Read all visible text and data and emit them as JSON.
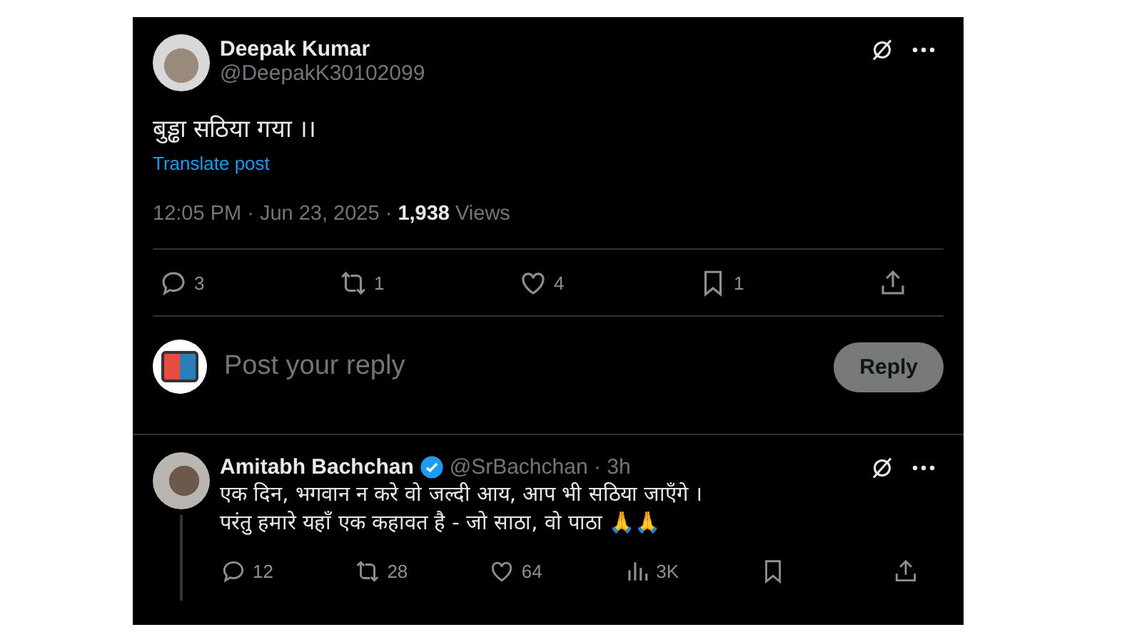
{
  "post": {
    "name": "Deepak Kumar",
    "handle": "@DeepakK30102099",
    "text": "बुड्ढा सठिया गया ।।",
    "translate": "Translate post",
    "time": "12:05 PM · Jun 23, 2025 · ",
    "views_count": "1,938",
    "views_label": " Views",
    "actions": [
      {
        "kind": "reply",
        "count": "3"
      },
      {
        "kind": "repost",
        "count": "1"
      },
      {
        "kind": "like",
        "count": "4"
      },
      {
        "kind": "bookmark",
        "count": "1"
      },
      {
        "kind": "share"
      }
    ]
  },
  "composer": {
    "placeholder": "Post your reply",
    "button": "Reply"
  },
  "reply": {
    "name": "Amitabh Bachchan",
    "verified": true,
    "handle": "@SrBachchan · 3h",
    "lines": [
      "एक दिन, भगवान न करे वो जल्दी आय, आप भी सठिया जाएँगे  ।",
      "परंतु हमारे यहाँ एक कहावत है  - जो साठा, वो पाठा 🙏🙏"
    ],
    "actions": [
      {
        "kind": "reply",
        "count": "12"
      },
      {
        "kind": "repost",
        "count": "28"
      },
      {
        "kind": "like",
        "count": "64"
      },
      {
        "kind": "views",
        "count": "3K"
      },
      {
        "kind": "bookmark"
      },
      {
        "kind": "share"
      }
    ]
  }
}
